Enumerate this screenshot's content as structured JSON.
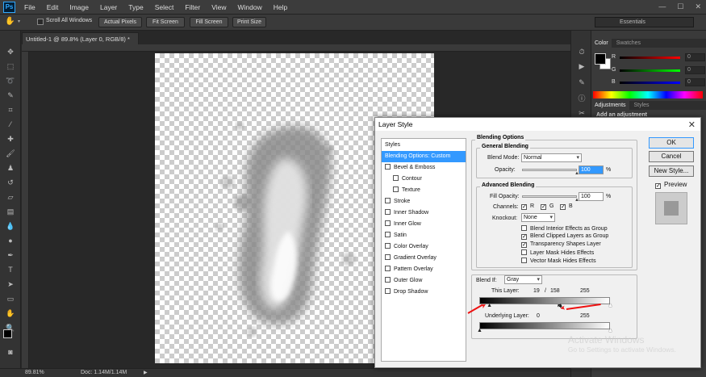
{
  "app": {
    "logo": "Ps",
    "menus": [
      "File",
      "Edit",
      "Image",
      "Layer",
      "Type",
      "Select",
      "Filter",
      "View",
      "Window",
      "Help"
    ],
    "window_controls": [
      "—",
      "☐",
      "✕"
    ]
  },
  "options_bar": {
    "scroll_all_windows": "Scroll All Windows",
    "buttons": [
      "Actual Pixels",
      "Fit Screen",
      "Fill Screen",
      "Print Size"
    ],
    "workspace": "Essentials"
  },
  "document": {
    "tab_title": "Untitled-1 @ 89.8% (Layer 0, RGB/8) *",
    "close": "×"
  },
  "status": {
    "zoom": "89.81%",
    "doc": "Doc: 1.14M/1.14M"
  },
  "right_panel": {
    "tabs_top": [
      "Color",
      "Swatches"
    ],
    "channels": [
      {
        "label": "R",
        "value": "0",
        "color": "#e02020"
      },
      {
        "label": "G",
        "value": "0",
        "color": "#20c020"
      },
      {
        "label": "B",
        "value": "0",
        "color": "#2040e0"
      }
    ],
    "tabs_mid": [
      "Adjustments",
      "Styles"
    ],
    "add_adjustment": "Add an adjustment"
  },
  "dialog": {
    "title": "Layer Style",
    "styles_header": "Styles",
    "styles": [
      {
        "label": "Blending Options: Custom",
        "checkbox": false,
        "selected": true,
        "indent": false
      },
      {
        "label": "Bevel & Emboss",
        "checkbox": true,
        "selected": false,
        "indent": false
      },
      {
        "label": "Contour",
        "checkbox": true,
        "selected": false,
        "indent": true
      },
      {
        "label": "Texture",
        "checkbox": true,
        "selected": false,
        "indent": true
      },
      {
        "label": "Stroke",
        "checkbox": true,
        "selected": false,
        "indent": false
      },
      {
        "label": "Inner Shadow",
        "checkbox": true,
        "selected": false,
        "indent": false
      },
      {
        "label": "Inner Glow",
        "checkbox": true,
        "selected": false,
        "indent": false
      },
      {
        "label": "Satin",
        "checkbox": true,
        "selected": false,
        "indent": false
      },
      {
        "label": "Color Overlay",
        "checkbox": true,
        "selected": false,
        "indent": false
      },
      {
        "label": "Gradient Overlay",
        "checkbox": true,
        "selected": false,
        "indent": false
      },
      {
        "label": "Pattern Overlay",
        "checkbox": true,
        "selected": false,
        "indent": false
      },
      {
        "label": "Outer Glow",
        "checkbox": true,
        "selected": false,
        "indent": false
      },
      {
        "label": "Drop Shadow",
        "checkbox": true,
        "selected": false,
        "indent": false
      }
    ],
    "blending_options": "Blending Options",
    "general_blending": "General Blending",
    "blend_mode_label": "Blend Mode:",
    "blend_mode_value": "Normal",
    "opacity_label": "Opacity:",
    "opacity_value": "100",
    "opacity_level": 1.0,
    "percent": "%",
    "advanced_blending": "Advanced Blending",
    "fill_opacity_label": "Fill Opacity:",
    "fill_opacity_value": "100",
    "fill_opacity_level": 1.0,
    "channels_label": "Channels:",
    "channels": [
      "R",
      "G",
      "B"
    ],
    "knockout_label": "Knockout:",
    "knockout_value": "None",
    "advanced_checks": [
      {
        "label": "Blend Interior Effects as Group",
        "checked": false
      },
      {
        "label": "Blend Clipped Layers as Group",
        "checked": true
      },
      {
        "label": "Transparency Shapes Layer",
        "checked": true
      },
      {
        "label": "Layer Mask Hides Effects",
        "checked": false
      },
      {
        "label": "Vector Mask Hides Effects",
        "checked": false
      }
    ],
    "blend_if_label": "Blend If:",
    "blend_if_value": "Gray",
    "this_layer_label": "This Layer:",
    "this_layer_low": "19",
    "this_layer_sep": "/",
    "this_layer_split": "158",
    "this_layer_high": "255",
    "this_layer_low_level": 19,
    "this_layer_split_level": 158,
    "this_layer_high_level": 255,
    "underlying_label": "Underlying Layer:",
    "underlying_low": "0",
    "underlying_high": "255",
    "underlying_low_level": 0,
    "underlying_high_level": 255,
    "buttons": {
      "ok": "OK",
      "cancel": "Cancel",
      "new_style": "New Style..."
    },
    "preview_label": "Preview",
    "close": "✕"
  },
  "watermark": {
    "line1": "Activate Windows",
    "line2": "Go to Settings to activate Windows."
  }
}
